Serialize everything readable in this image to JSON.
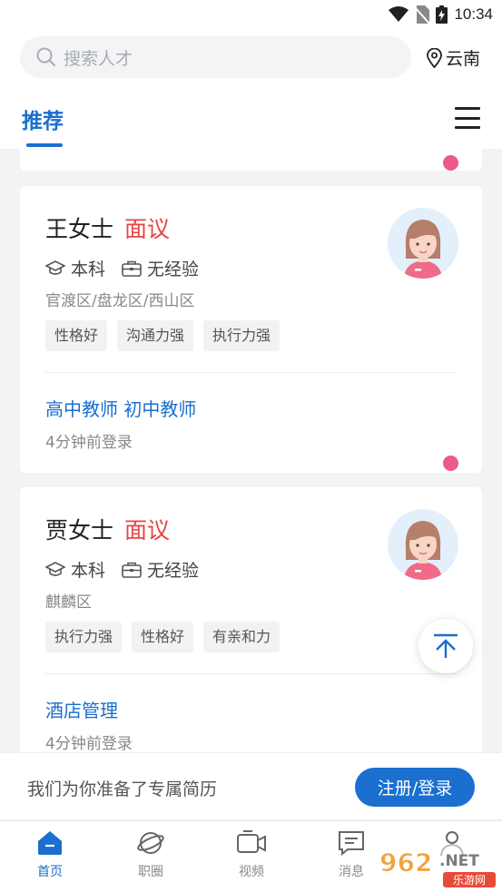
{
  "status_bar": {
    "time": "10:34"
  },
  "search": {
    "placeholder": "搜索人才"
  },
  "location": {
    "label": "云南"
  },
  "tabs": {
    "active_label": "推荐"
  },
  "cards": [
    {
      "name": "王女士",
      "salary": "面议",
      "education": "本科",
      "experience": "无经验",
      "area": "官渡区/盘龙区/西山区",
      "tags": [
        "性格好",
        "沟通力强",
        "执行力强"
      ],
      "job_title": "高中教师 初中教师",
      "login_time": "4分钟前登录"
    },
    {
      "name": "贾女士",
      "salary": "面议",
      "education": "本科",
      "experience": "无经验",
      "area": "麒麟区",
      "tags": [
        "执行力强",
        "性格好",
        "有亲和力"
      ],
      "job_title": "酒店管理",
      "login_time": "4分钟前登录"
    }
  ],
  "banner": {
    "text": "我们为你准备了专属简历",
    "button_label": "注册/登录"
  },
  "bottom_nav": {
    "items": [
      {
        "label": "首页",
        "icon": "home-icon",
        "active": true
      },
      {
        "label": "职圈",
        "icon": "planet-icon",
        "active": false
      },
      {
        "label": "视频",
        "icon": "video-icon",
        "active": false
      },
      {
        "label": "消息",
        "icon": "message-icon",
        "active": false
      },
      {
        "label": "",
        "icon": "profile-icon",
        "active": false
      }
    ]
  },
  "watermark": {
    "text": "962.NET",
    "subtext": "乐游网"
  },
  "colors": {
    "accent": "#1a6fcf",
    "salary": "#e64545",
    "badge": "#ec5a8d"
  }
}
